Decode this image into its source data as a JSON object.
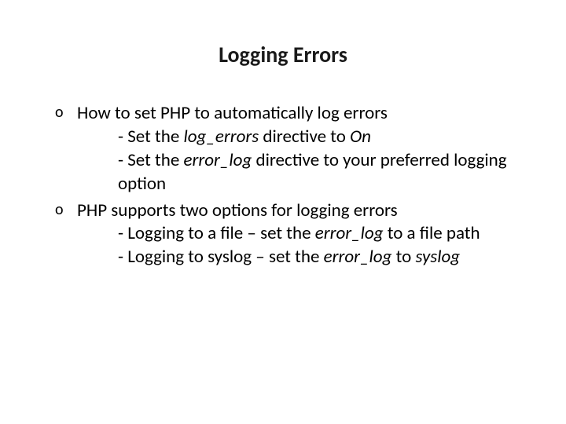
{
  "title": "Logging Errors",
  "bullets": {
    "b0": {
      "text": "How to set PHP to automatically log errors",
      "s0_pre": "- Set the ",
      "s0_i": "log_errors",
      "s0_mid": " directive to ",
      "s0_i2": "On",
      "s1_pre": "- Set the ",
      "s1_i": "error_log",
      "s1_post": " directive to your preferred logging option"
    },
    "b1": {
      "text": "PHP supports two options for logging errors",
      "s0_pre": "- Logging to a file – set the ",
      "s0_i": "error_log",
      "s0_post": " to a file path",
      "s1_pre": "- Logging to syslog – set the ",
      "s1_i": "error_log",
      "s1_mid": " to ",
      "s1_i2": "syslog"
    }
  }
}
